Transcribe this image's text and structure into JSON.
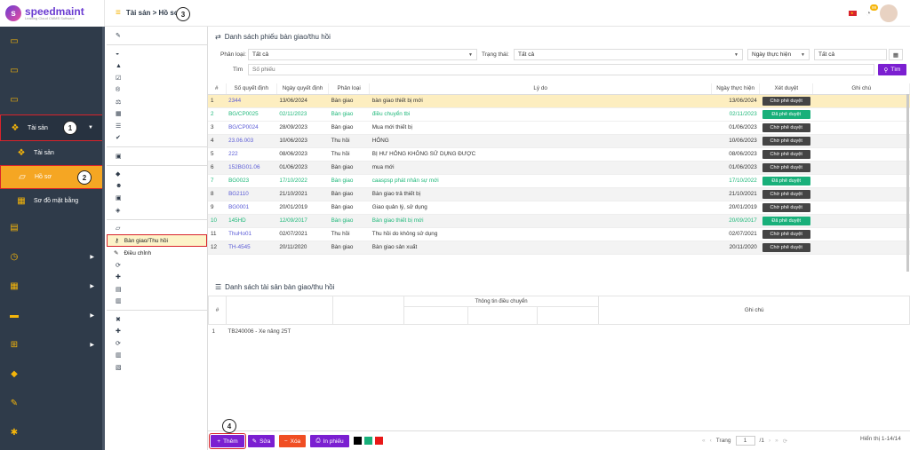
{
  "app": {
    "brand": "speedmaint",
    "tagline": "Leading Cloud CMMS Software"
  },
  "header": {
    "breadcrumb": "Tài sản > Hồ sơ",
    "notify_count": "99"
  },
  "sidebar": {
    "assets_label": "Tài sản",
    "sub_assets": "Tài sản",
    "sub_records": "Hồ sơ",
    "sub_map": "Sơ đồ mặt bằng",
    "callouts": [
      "1",
      "2",
      "3",
      "4"
    ]
  },
  "subnav": {
    "handover": "Bàn giao/Thu hồi",
    "adjust": "Điều chỉnh"
  },
  "section1": {
    "title": "Danh sách phiếu bàn giao/thu hồi"
  },
  "filters": {
    "type_label": "Phân loại:",
    "type_value": "Tất cả",
    "status_label": "Trạng thái:",
    "status_value": "Tất cả",
    "date_field": "Ngày thực hiện",
    "date_value": "Tất cả",
    "search_label": "Tìm",
    "search_placeholder": "Số phiếu",
    "search_button": "Tìm"
  },
  "grid1": {
    "headers": [
      "#",
      "Số quyết định",
      "Ngày quyết định",
      "Phân loại",
      "Lý do",
      "Ngày thực hiện",
      "Xét duyệt",
      "Ghi chú"
    ],
    "rows": [
      {
        "n": "1",
        "code": "2344",
        "date": "13/06/2024",
        "type": "Bàn giao",
        "reason": "bàn giao thiết bị mới",
        "exec": "13/06/2024",
        "status": "Chờ phê duyệt"
      },
      {
        "n": "2",
        "code": "BG/CP0025",
        "date": "02/11/2023",
        "type": "Bàn giao",
        "reason": "điều chuyển tbi",
        "exec": "02/11/2023",
        "status": "Đã phê duyệt"
      },
      {
        "n": "3",
        "code": "BG/CP0024",
        "date": "28/09/2023",
        "type": "Bàn giao",
        "reason": "Mua mới thiết bị",
        "exec": "01/06/2023",
        "status": "Chờ phê duyệt"
      },
      {
        "n": "4",
        "code": "23.06.003",
        "date": "10/06/2023",
        "type": "Thu hồi",
        "reason": "HỎNG",
        "exec": "10/06/2023",
        "status": "Chờ phê duyệt"
      },
      {
        "n": "5",
        "code": "222",
        "date": "08/06/2023",
        "type": "Thu hồi",
        "reason": "BỊ HƯ HỎNG KHÔNG SỬ DỤNG ĐƯỢC",
        "exec": "08/06/2023",
        "status": "Chờ phê duyệt"
      },
      {
        "n": "6",
        "code": "152BG01.06",
        "date": "01/06/2023",
        "type": "Bàn giao",
        "reason": "mua mới",
        "exec": "01/06/2023",
        "status": "Chờ phê duyệt"
      },
      {
        "n": "7",
        "code": "BG0023",
        "date": "17/10/2022",
        "type": "Bàn giao",
        "reason": "caaspsp phát nhân sự mới",
        "exec": "17/10/2022",
        "status": "Đã phê duyệt"
      },
      {
        "n": "8",
        "code": "BG2110",
        "date": "21/10/2021",
        "type": "Bàn giao",
        "reason": "Bàn giao trả thiết bị",
        "exec": "21/10/2021",
        "status": "Chờ phê duyệt"
      },
      {
        "n": "9",
        "code": "BG0001",
        "date": "20/01/2019",
        "type": "Bàn giao",
        "reason": "Giao quản lý, sử dụng",
        "exec": "20/01/2019",
        "status": "Chờ phê duyệt"
      },
      {
        "n": "10",
        "code": "145HD",
        "date": "12/09/2017",
        "type": "Bàn giao",
        "reason": "Bàn giao thiết bị mới",
        "exec": "20/09/2017",
        "status": "Đã phê duyệt"
      },
      {
        "n": "11",
        "code": "ThuHo01",
        "date": "02/07/2021",
        "type": "Thu hồi",
        "reason": "Thu hồi do không sử dụng",
        "exec": "02/07/2021",
        "status": "Chờ phê duyệt"
      },
      {
        "n": "12",
        "code": "TH-4545",
        "date": "20/11/2020",
        "type": "Bàn giao",
        "reason": "Bàn giao sản xuất",
        "exec": "20/11/2020",
        "status": "Chờ phê duyệt"
      }
    ]
  },
  "section2": {
    "title": "Danh sách tài sản bàn giao/thu hồi",
    "group_header": "Thông tin điều chuyển",
    "note_header": "Ghi chú",
    "hash": "#"
  },
  "grid2": {
    "rows": [
      {
        "n": "1",
        "asset": "TB240006 - Xe nâng 25T"
      }
    ]
  },
  "toolbar": {
    "add": "Thêm",
    "edit": "Sửa",
    "delete": "Xóa",
    "print": "In phiếu",
    "page_label": "Trang",
    "page_value": "1",
    "page_total": "/1",
    "range": "Hiển thị 1-14/14"
  },
  "colors": {
    "accent": "#7b1fd1",
    "sidebar": "#2f3b4a",
    "icon": "#f5b50a",
    "approved": "#19b07a",
    "pending": "#444444",
    "delete": "#f04e23"
  }
}
